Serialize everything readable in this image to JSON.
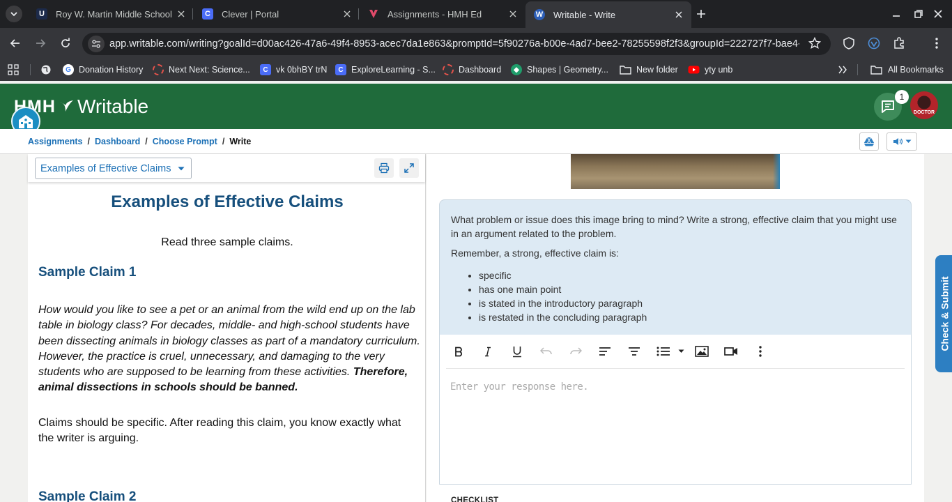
{
  "browser": {
    "tabs": [
      {
        "title": "Roy W. Martin Middle School",
        "favicon": "U",
        "favicon_color": "#1c2a4a",
        "active": false
      },
      {
        "title": "Clever | Portal",
        "favicon": "C",
        "favicon_color": "#4a6cf7",
        "active": false
      },
      {
        "title": "Assignments - HMH Ed",
        "favicon": "hmh-icon",
        "favicon_color": "#e04a6a",
        "active": false
      },
      {
        "title": "Writable - Write",
        "favicon": "W",
        "favicon_color": "#2d5fb8",
        "active": true
      }
    ],
    "url": "app.writable.com/writing?goalId=d00ac426-47a6-49f4-8953-acec7da1e863&promptId=5f90276a-b00e-4ad7-bee2-78255598f2f3&groupId=222727f7-bae4-...",
    "bookmarks": [
      {
        "label": "Donation History",
        "icon": "google-icon"
      },
      {
        "label": "Next Next: Science...",
        "icon": "dashed-circle-icon"
      },
      {
        "label": "vk 0bhBY trN",
        "icon": "clever-icon"
      },
      {
        "label": "ExploreLearning - S...",
        "icon": "clever-icon"
      },
      {
        "label": "Dashboard",
        "icon": "dashed-circle-icon"
      },
      {
        "label": "Shapes | Geometry...",
        "icon": "shapes-icon"
      },
      {
        "label": "New folder",
        "icon": "folder-icon"
      },
      {
        "label": "yty unb",
        "icon": "youtube-icon"
      }
    ],
    "all_bookmarks": "All Bookmarks"
  },
  "app": {
    "logo_hmh": "HMH",
    "logo_product": "Writable",
    "notification_count": "1",
    "avatar_text": "DOCTOR"
  },
  "breadcrumb": {
    "items": [
      "Assignments",
      "Dashboard",
      "Choose Prompt"
    ],
    "current": "Write"
  },
  "left": {
    "resource_select": "Examples of Effective Claims",
    "title": "Examples of Effective Claims",
    "intro": "Read three sample claims.",
    "claim1_heading": "Sample Claim 1",
    "claim1_text": "How would you like to see a pet or an animal from the wild end up on the lab table in biology class? For decades, middle- and high-school students have been dissecting animals in biology classes as part of a mandatory curriculum. However, the practice is cruel, unnecessary, and damaging to the very students who are supposed to be learning from these activities.",
    "claim1_bold": "Therefore, animal dissections in schools should be banned.",
    "claim1_note": "Claims should be specific. After reading this claim, you know exactly what the writer is arguing.",
    "claim2_heading": "Sample Claim 2"
  },
  "right": {
    "prompt_question": "What problem or issue does this image bring to mind? Write a strong, effective claim that you might use in an argument related to the problem.",
    "prompt_remember": "Remember, a strong, effective claim is:",
    "prompt_points": [
      "specific",
      "has one main point",
      "is stated in the introductory paragraph",
      "is restated in the concluding paragraph"
    ],
    "editor_placeholder": "Enter your response here.",
    "checklist_label": "CHECKLIST",
    "submit_label": "Check & Submit"
  },
  "colors": {
    "header_green": "#1f6b3b",
    "link_blue": "#1a6fb5",
    "heading_navy": "#164f7c",
    "prompt_bg": "#ddeaf4",
    "submit_blue": "#2d7fc2"
  }
}
